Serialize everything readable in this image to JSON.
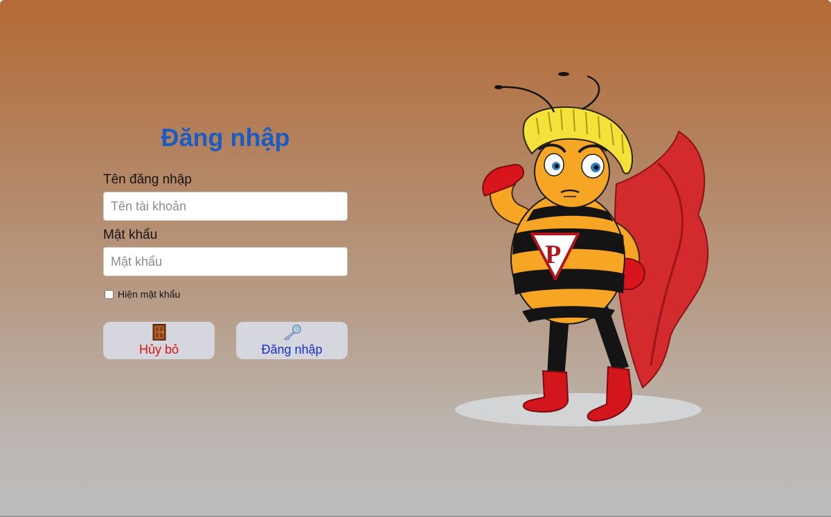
{
  "form": {
    "title": "Đăng nhập",
    "username_label": "Tên đăng nhập",
    "username_placeholder": "Tên tài khoản",
    "username_value": "",
    "password_label": "Mật khẩu",
    "password_placeholder": "Mật khẩu",
    "password_value": "",
    "show_password_label": "Hiện mật khẩu",
    "show_password_checked": false
  },
  "buttons": {
    "cancel_label": "Hủy bỏ",
    "cancel_icon": "door-icon",
    "login_label": "Đăng nhập",
    "login_icon": "key-icon"
  },
  "colors": {
    "title": "#1a5bc4",
    "cancel_text": "#e01010",
    "login_text": "#1530c8",
    "button_bg": "#d5d6de"
  },
  "illustration": {
    "subject": "bee-superhero-mascot"
  }
}
